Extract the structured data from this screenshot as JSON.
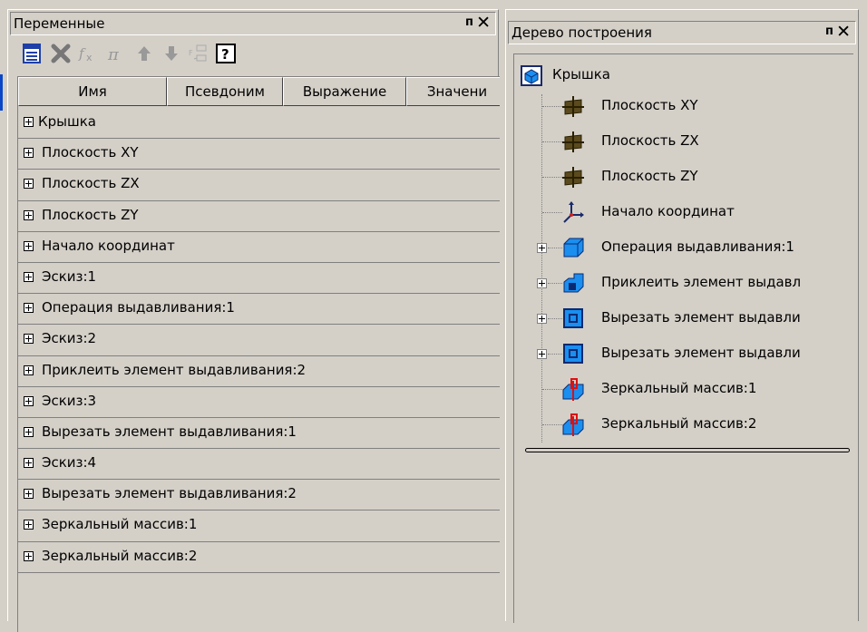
{
  "variables_panel": {
    "title": "Переменные",
    "pin_label": "ᴨ",
    "close_label": "✕",
    "toolbar": [
      {
        "icon": "table-icon"
      },
      {
        "icon": "delete-icon"
      },
      {
        "icon": "function-icon"
      },
      {
        "icon": "pi-icon"
      },
      {
        "icon": "arrow-up-icon"
      },
      {
        "icon": "arrow-down-icon"
      },
      {
        "icon": "rename-icon"
      },
      {
        "icon": "help-icon"
      }
    ],
    "columns": [
      "Имя",
      "Псевдоним",
      "Выражение",
      "Значени"
    ],
    "rows": [
      "Крышка",
      "Плоскость XY",
      "Плоскость ZX",
      "Плоскость ZY",
      "Начало координат",
      "Эскиз:1",
      "Операция выдавливания:1",
      "Эскиз:2",
      "Приклеить элемент выдавливания:2",
      "Эскиз:3",
      "Вырезать элемент выдавливания:1",
      "Эскиз:4",
      "Вырезать элемент выдавливания:2",
      "Зеркальный массив:1",
      "Зеркальный массив:2"
    ]
  },
  "tree_panel": {
    "title": "Дерево построения",
    "pin_label": "ᴨ",
    "close_label": "✕",
    "root": {
      "label": "Крышка",
      "icon": "part-icon"
    },
    "items": [
      {
        "label": "Плоскость XY",
        "icon": "plane-icon",
        "expandable": false
      },
      {
        "label": "Плоскость ZX",
        "icon": "plane-icon",
        "expandable": false
      },
      {
        "label": "Плоскость ZY",
        "icon": "plane-icon",
        "expandable": false
      },
      {
        "label": "Начало координат",
        "icon": "origin-icon",
        "expandable": false
      },
      {
        "label": "Операция выдавливания:1",
        "icon": "extrude-icon",
        "expandable": true
      },
      {
        "label": "Приклеить элемент выдавл",
        "icon": "boss-extrude-icon",
        "expandable": true
      },
      {
        "label": "Вырезать элемент выдавли",
        "icon": "cut-extrude-icon",
        "expandable": true
      },
      {
        "label": "Вырезать элемент выдавли",
        "icon": "cut-extrude-icon",
        "expandable": true
      },
      {
        "label": "Зеркальный массив:1",
        "icon": "mirror-icon",
        "expandable": false
      },
      {
        "label": "Зеркальный массив:2",
        "icon": "mirror-icon",
        "expandable": false
      }
    ]
  },
  "colors": {
    "window_bg": "#d4d0c8",
    "icon_blue": "#1a8ff0",
    "plane_brown": "#5a4a1e"
  }
}
